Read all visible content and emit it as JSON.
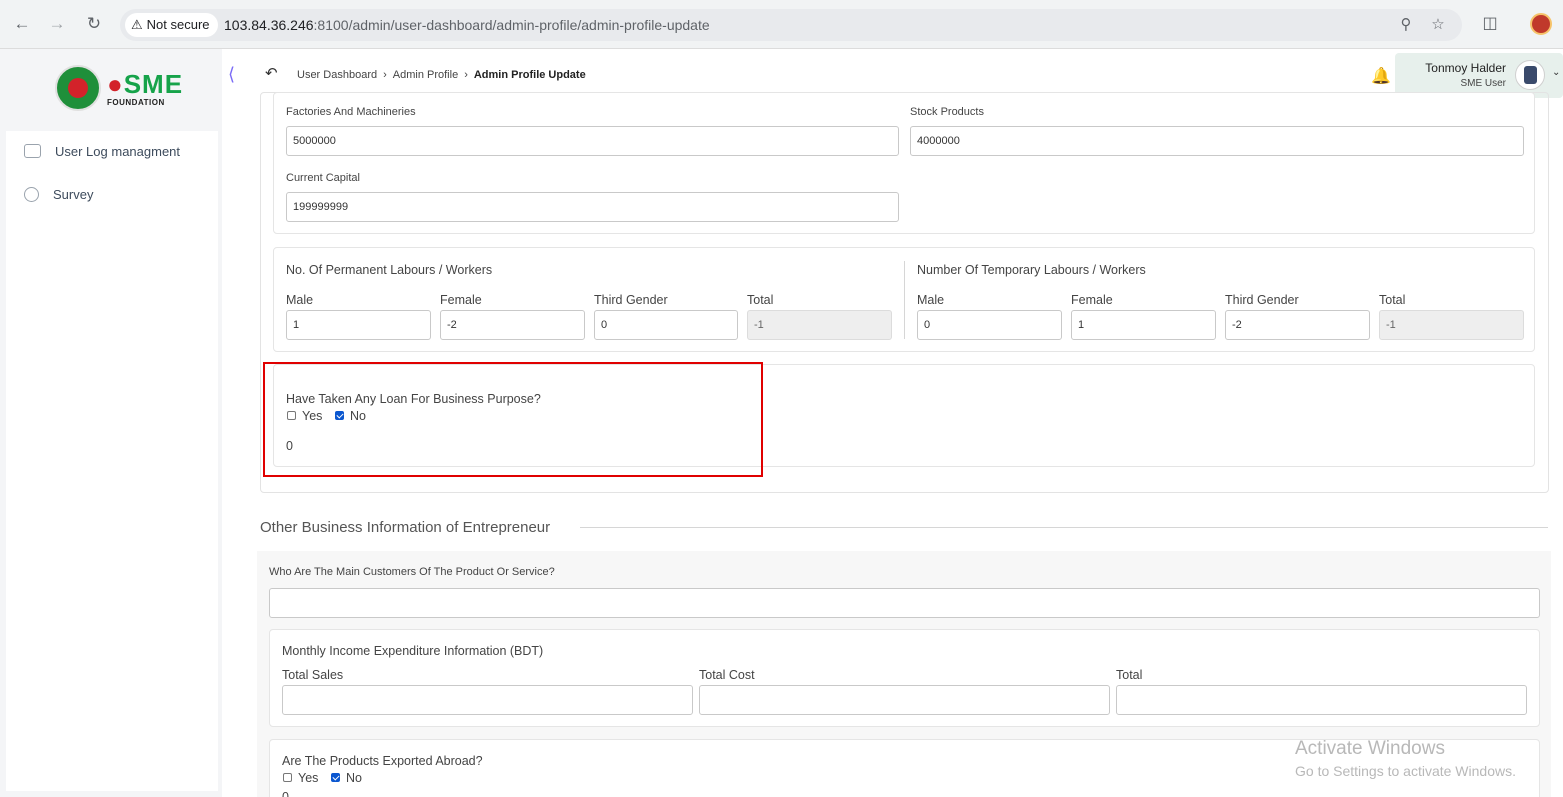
{
  "browser": {
    "security_label": "Not secure",
    "url_host": "103.84.36.246",
    "url_rest": ":8100/admin/user-dashboard/admin-profile/admin-profile-update"
  },
  "sidebar": {
    "items": [
      {
        "label": "User Log managment",
        "icon": "log-icon"
      },
      {
        "label": "Survey",
        "icon": "pie-chart-icon"
      }
    ],
    "logo_text_1": "SME",
    "logo_sub": "FOUNDATION"
  },
  "header": {
    "breadcrumb": [
      "User Dashboard",
      "Admin Profile",
      "Admin Profile Update"
    ],
    "user_name": "Tonmoy Halder",
    "user_role": "SME User"
  },
  "capital": {
    "factories_label": "Factories And Machineries",
    "factories_value": "5000000",
    "stock_label": "Stock Products",
    "stock_value": "4000000",
    "current_label": "Current Capital",
    "current_value": "199999999"
  },
  "labours": {
    "permanent_title": "No. Of Permanent Labours / Workers",
    "temporary_title": "Number Of Temporary Labours / Workers",
    "col_male": "Male",
    "col_female": "Female",
    "col_third": "Third Gender",
    "col_total": "Total",
    "permanent": {
      "male": "1",
      "female": "-2",
      "third": "0",
      "total": "-1"
    },
    "temporary": {
      "male": "0",
      "female": "1",
      "third": "-2",
      "total": "-1"
    }
  },
  "loan": {
    "question": "Have Taken Any Loan For Business Purpose?",
    "yes_label": "Yes",
    "no_label": "No",
    "value": "0"
  },
  "other": {
    "section_title": "Other Business Information of Entrepreneur",
    "customers_label": "Who Are The Main Customers Of The Product Or Service?",
    "customers_value": "",
    "income_title": "Monthly Income Expenditure Information (BDT)",
    "total_sales_label": "Total Sales",
    "total_cost_label": "Total Cost",
    "total_label": "Total",
    "export_question": "Are The Products Exported Abroad?",
    "export_yes": "Yes",
    "export_no": "No",
    "export_value": "0"
  },
  "watermark": {
    "line1": "Activate Windows",
    "line2": "Go to Settings to activate Windows."
  }
}
